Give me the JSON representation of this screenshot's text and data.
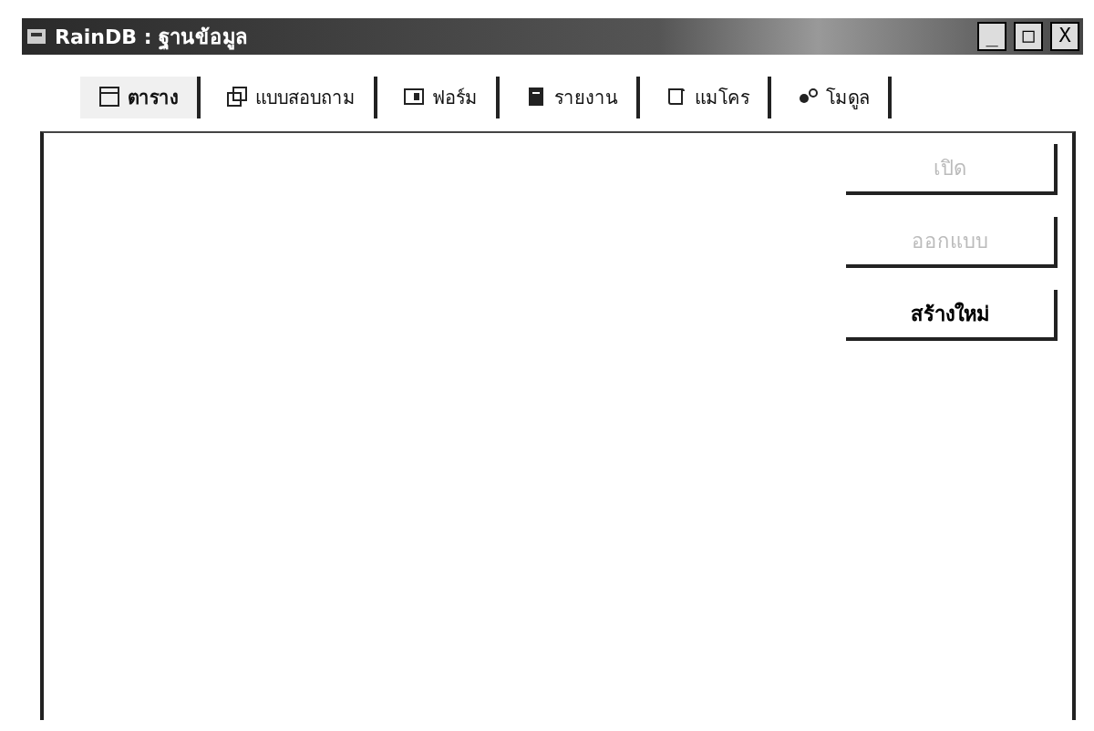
{
  "window": {
    "title": "RainDB : ฐานข้อมูล",
    "controls": [
      "_",
      "□",
      "X"
    ]
  },
  "tabs": [
    {
      "label": "ตาราง",
      "selected": true,
      "kind": "table"
    },
    {
      "label": "แบบสอบถาม",
      "selected": false,
      "kind": "query"
    },
    {
      "label": "ฟอร์ม",
      "selected": false,
      "kind": "form"
    },
    {
      "label": "รายงาน",
      "selected": false,
      "kind": "report"
    },
    {
      "label": "แมโคร",
      "selected": false,
      "kind": "macro"
    },
    {
      "label": "โมดูล",
      "selected": false,
      "kind": "module"
    }
  ],
  "buttons": [
    {
      "label": "เปิด",
      "disabled": true
    },
    {
      "label": "ออกแบบ",
      "disabled": true
    },
    {
      "label": "สร้างใหม่",
      "disabled": false
    }
  ]
}
